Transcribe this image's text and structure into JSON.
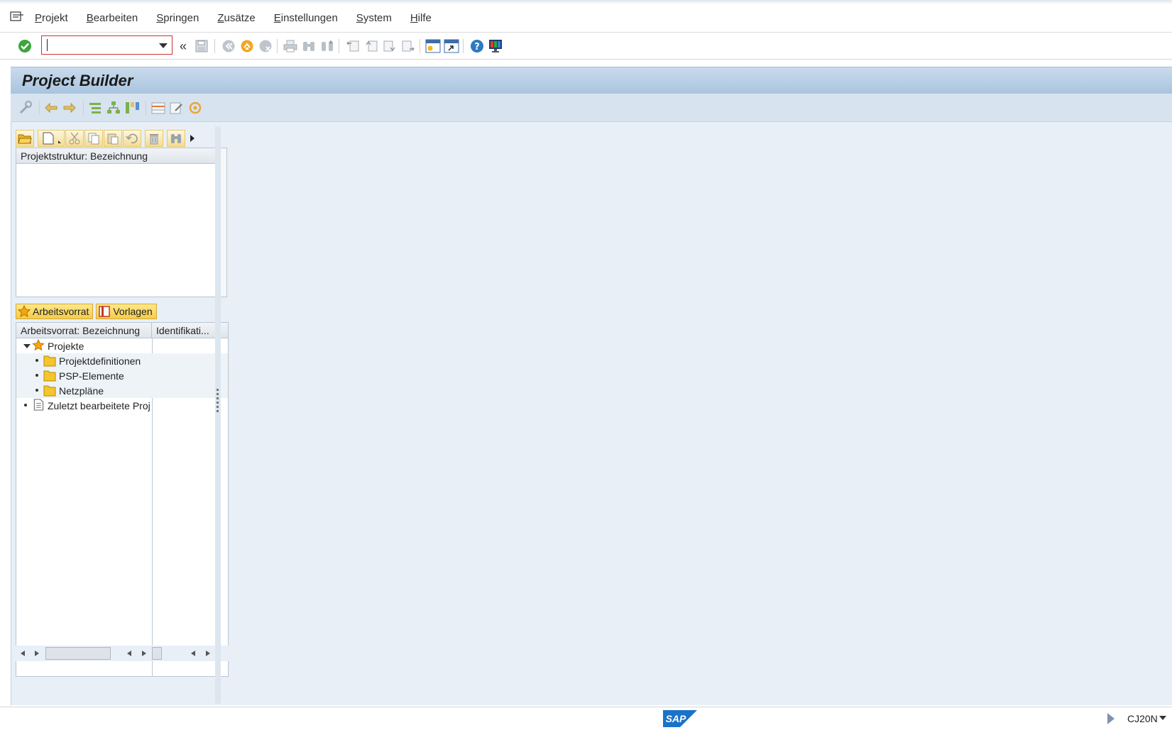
{
  "menu": {
    "items": [
      "Projekt",
      "Bearbeiten",
      "Springen",
      "Zusätze",
      "Einstellungen",
      "System",
      "Hilfe"
    ]
  },
  "toolbar": {
    "command_value": "",
    "expand_glyph": "«"
  },
  "title": "Project Builder",
  "structure_grid": {
    "header": "Projektstruktur: Bezeichnung"
  },
  "tabs": [
    "Arbeitsvorrat",
    "Vorlagen"
  ],
  "worklist_grid": {
    "col1": "Arbeitsvorrat: Bezeichnung",
    "col2": "Identifikati...",
    "rows": [
      {
        "label": "Projekte",
        "icon": "star-icon",
        "level": 0,
        "expanded": true
      },
      {
        "label": "Projektdefinitionen",
        "icon": "folder-icon",
        "level": 1
      },
      {
        "label": "PSP-Elemente",
        "icon": "folder-icon",
        "level": 1
      },
      {
        "label": "Netzpläne",
        "icon": "folder-icon",
        "level": 1
      },
      {
        "label": "Zuletzt bearbeitete Proj",
        "icon": "document-icon",
        "level": 0
      }
    ]
  },
  "status": {
    "tcode": "CJ20N",
    "logo": "SAP"
  },
  "colors": {
    "title_bar": "#aac4df",
    "content_bg": "#e8eff7",
    "tab_yellow": "#f5cc47"
  }
}
